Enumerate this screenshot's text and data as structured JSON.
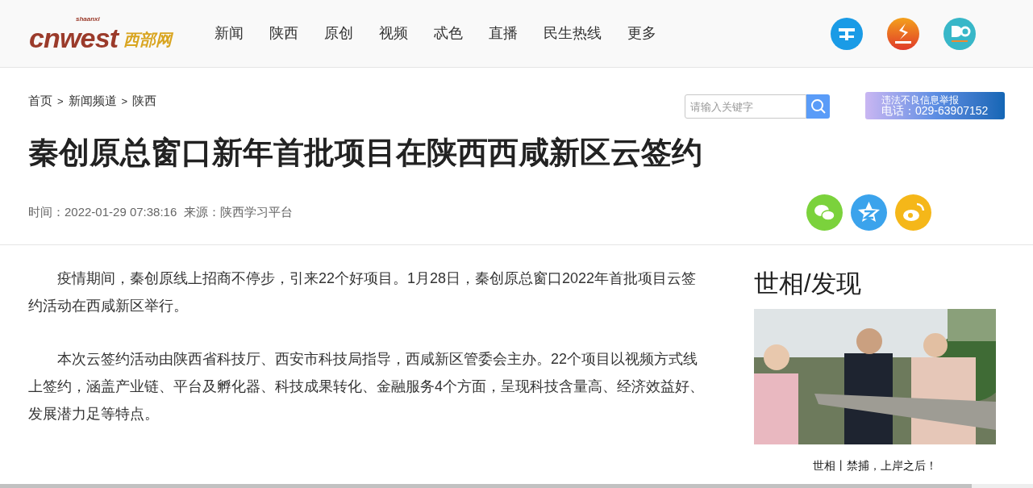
{
  "logo": {
    "main": "cnwest",
    "sub": "shaanxi",
    "cn": "西部网"
  },
  "nav": [
    {
      "label": "新闻"
    },
    {
      "label": "陕西"
    },
    {
      "label": "原创"
    },
    {
      "label": "视频"
    },
    {
      "label": "忒色"
    },
    {
      "label": "直播"
    },
    {
      "label": "民生热线"
    },
    {
      "label": "更多"
    }
  ],
  "breadcrumb": [
    "首页",
    "新闻频道",
    "陕西"
  ],
  "breadcrumb_separator": ">",
  "search": {
    "placeholder": "请输入关键字"
  },
  "report_banner": {
    "line1": "违法不良信息举报",
    "line2": "电话：029-63907152"
  },
  "article": {
    "title": "秦创原总窗口新年首批项目在陕西西咸新区云签约",
    "meta": "时间：2022-01-29 07:38:16  来源：陕西学习平台",
    "paragraphs": [
      "疫情期间，秦创原线上招商不停步，引来22个好项目。1月28日，秦创原总窗口2022年首批项目云签约活动在西咸新区举行。",
      "本次云签约活动由陕西省科技厅、西安市科技局指导，西咸新区管委会主办。22个项目以视频方式线上签约，涵盖产业链、平台及孵化器、科技成果转化、金融服务4个方面，呈现科技含量高、经济效益好、发展潜力足等特点。"
    ]
  },
  "sidebar": {
    "heading": "世相/发现",
    "caption": "世相丨禁捕，上岸之后！"
  }
}
